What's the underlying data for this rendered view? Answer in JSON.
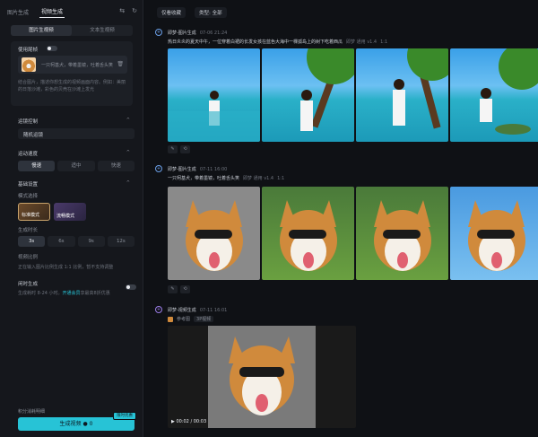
{
  "left": {
    "tabs": [
      "图片生成",
      "视频生成"
    ],
    "active_tab": 1,
    "sub_tabs": [
      "图片生视频",
      "文本生视频"
    ],
    "use_ref_label": "使用尾帧",
    "ref_text": "一只柯基犬，带着墨镜，吐着舌头笑",
    "hint": "结合图片，描述你想生成的视频画面内容。例如：美丽的日落沙滩，彩色的贝壳在沙滩上发光",
    "camera_label": "运镜控制",
    "camera_value": "随机运镜",
    "speed_label": "运动速度",
    "speed_options": [
      "慢速",
      "适中",
      "快速"
    ],
    "basic_label": "基础设置",
    "mode_label": "模式选择",
    "modes": [
      "标准模式",
      "流畅模式"
    ],
    "duration_label": "生成时长",
    "durations": [
      "3s",
      "6s",
      "9s",
      "12s"
    ],
    "ratio_label": "视频比例",
    "ratio_hint": "正在输入图片比例生成 1:1 比例，暂不支持调整",
    "free_label": "闲时生成",
    "free_hint": "生成耗时 8-24 小时。",
    "free_link": "开通会员",
    "free_hint2": "享最高8折优惠",
    "footer_text": "积分消耗明细",
    "generate_label": "生成视频",
    "generate_cost": "0",
    "generate_badge": "限时优惠"
  },
  "right": {
    "filters": [
      "仅看收藏",
      "类型: 全部"
    ],
    "entries": [
      {
        "title": "即梦-图片生成",
        "time": "07-06 21:24",
        "prompt": "热日炎炎的夏天中午，一位穿着白裙的长发女孩在蓝色大海中一棵孤岛上的树下吃着西瓜",
        "meta": "即梦 通用 v1.4",
        "ratio": "1:1"
      },
      {
        "title": "即梦-图片生成",
        "time": "07-11 16:00",
        "prompt": "一只柯基犬，带着墨镜，吐着舌头笑",
        "meta": "即梦 通用 v1.4",
        "ratio": "1:1"
      },
      {
        "title": "即梦-视频生成",
        "time": "07-11 16:01",
        "ref": "参考图",
        "tag": "3P视频",
        "video_time": "00:02 / 00:03"
      }
    ]
  }
}
